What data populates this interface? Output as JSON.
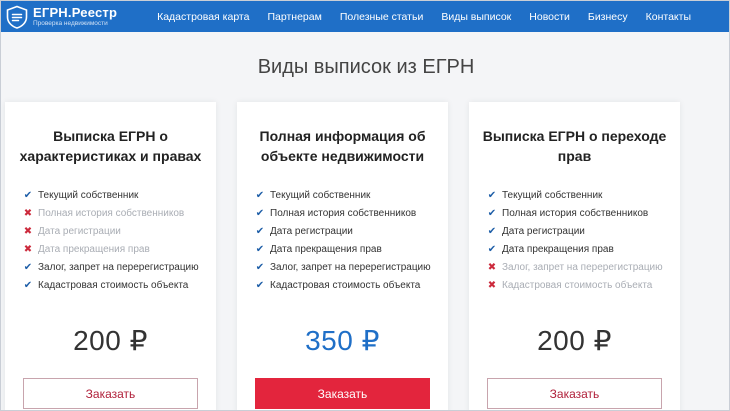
{
  "header": {
    "logo_title": "ЕГРН.Реестр",
    "logo_subtitle": "Проверка недвижимости",
    "nav": [
      "Кадастровая карта",
      "Партнерам",
      "Полезные статьи",
      "Виды выписок",
      "Новости",
      "Бизнесу",
      "Контакты"
    ],
    "color": "#1f6fc7"
  },
  "page_title": "Виды выписок из ЕГРН",
  "cards": [
    {
      "title": "Выписка ЕГРН о характеристиках и правах",
      "features": [
        {
          "label": "Текущий собственник",
          "included": true
        },
        {
          "label": "Полная история собственников",
          "included": false
        },
        {
          "label": "Дата регистрации",
          "included": false
        },
        {
          "label": "Дата прекращения прав",
          "included": false
        },
        {
          "label": "Залог, запрет на перерегистрацию",
          "included": true
        },
        {
          "label": "Кадастровая стоимость объекта",
          "included": true
        }
      ],
      "price": "200 ₽",
      "button": "Заказать"
    },
    {
      "title": "Полная информация об объекте недвижимости",
      "features": [
        {
          "label": "Текущий собственник",
          "included": true
        },
        {
          "label": "Полная история собственников",
          "included": true
        },
        {
          "label": "Дата регистрации",
          "included": true
        },
        {
          "label": "Дата прекращения прав",
          "included": true
        },
        {
          "label": "Залог, запрет на перерегистрацию",
          "included": true
        },
        {
          "label": "Кадастровая стоимость объекта",
          "included": true
        }
      ],
      "price": "350 ₽",
      "button": "Заказать"
    },
    {
      "title": "Выписка ЕГРН о переходе прав",
      "features": [
        {
          "label": "Текущий собственник",
          "included": true
        },
        {
          "label": "Полная история собственников",
          "included": true
        },
        {
          "label": "Дата регистрации",
          "included": true
        },
        {
          "label": "Дата прекращения прав",
          "included": true
        },
        {
          "label": "Залог, запрет на перерегистрацию",
          "included": false
        },
        {
          "label": "Кадастровая стоимость объекта",
          "included": false
        }
      ],
      "price": "200 ₽",
      "button": "Заказать"
    }
  ],
  "colors": {
    "accent_blue": "#1f6fc7",
    "check": "#1f5fa8",
    "cross": "#cc2a3c",
    "primary_button": "#e3253d"
  },
  "icons": {
    "included": "check-icon",
    "excluded": "cross-icon",
    "logo": "house-shield-icon"
  }
}
